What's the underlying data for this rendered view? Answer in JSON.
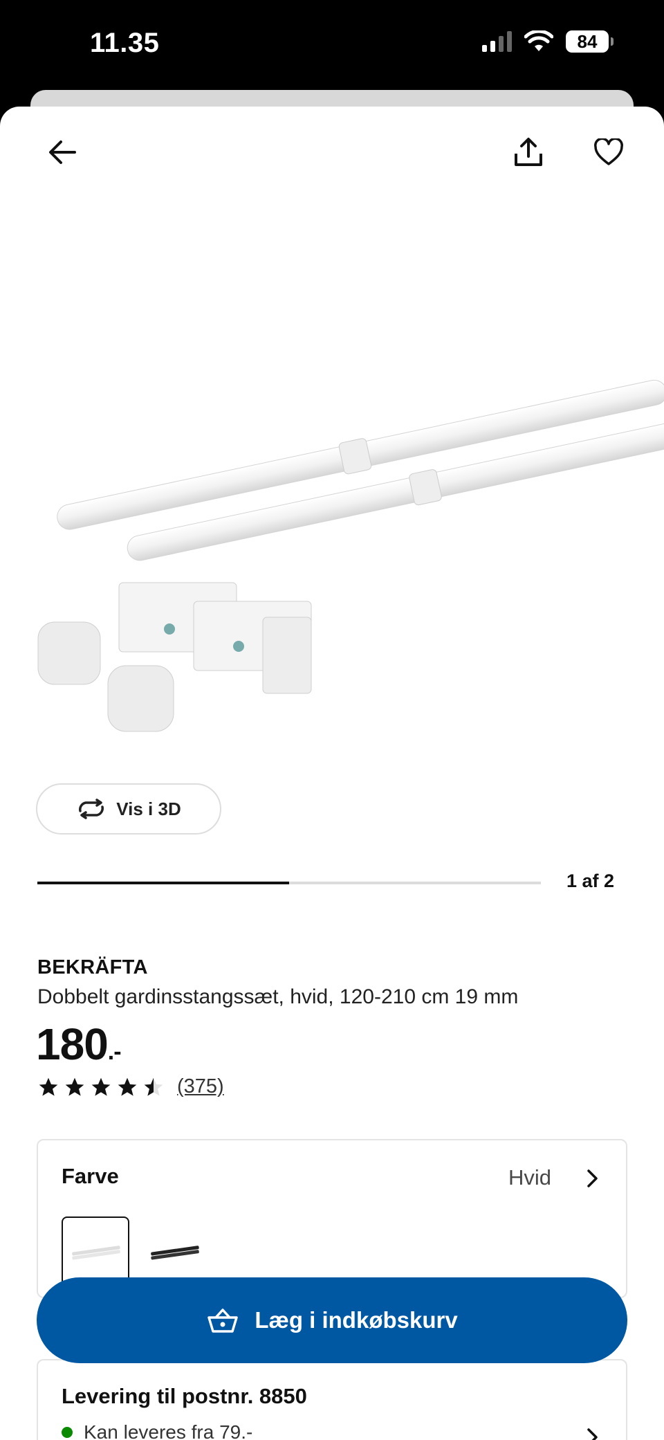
{
  "status_bar": {
    "time": "11.35",
    "battery": "84"
  },
  "product": {
    "brand": "BEKRÄFTA",
    "description": "Dobbelt gardinsstangssæt, hvid, 120-210 cm 19 mm",
    "price": "180",
    "price_suffix": ".-",
    "rating_value": 4.5,
    "rating_max": 5,
    "review_count": "(375)"
  },
  "gallery": {
    "view_3d_label": "Vis i 3D",
    "page_counter": "1 af 2",
    "progress_fraction": 0.5
  },
  "color_selector": {
    "label": "Farve",
    "value": "Hvid",
    "swatches": [
      "white",
      "black"
    ]
  },
  "delivery": {
    "title": "Levering til postnr. 8850",
    "status": "Kan leveres fra 79.-"
  },
  "cart_button": {
    "label": "Læg i indkøbskurv"
  },
  "icons": {
    "back": "arrow-left-icon",
    "share": "share-icon",
    "favorite": "heart-icon",
    "rotate3d": "rotate-3d-icon",
    "cart": "basket-icon"
  },
  "colors": {
    "accent": "#0058a3",
    "available": "#0a8a00"
  }
}
